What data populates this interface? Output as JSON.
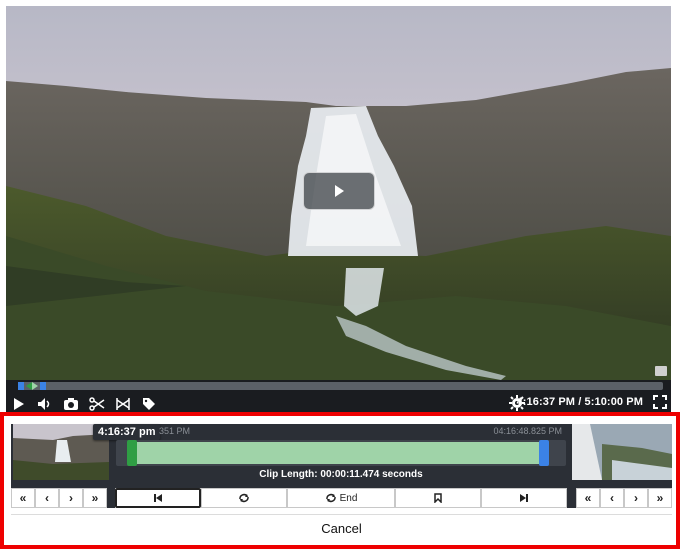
{
  "player": {
    "current_time": "4:16:37 PM",
    "separator": "/",
    "end_time": "5:10:00 PM",
    "icons": {
      "play": "play-icon",
      "volume": "volume-icon",
      "snapshot": "camera-icon",
      "clip": "scissors-icon",
      "export": "export-icon",
      "tag": "tag-icon",
      "settings": "gear-icon",
      "fullscreen": "fullscreen-icon"
    }
  },
  "clip_editor": {
    "hover_time": "4:16:37 pm",
    "range_start_label": "351 PM",
    "range_end_label": "04:16:48.825 PM",
    "clip_length": "Clip Length: 00:00:11.474 seconds",
    "nav_left": [
      "«",
      "‹",
      "›",
      "»"
    ],
    "nav_right": [
      "«",
      "‹",
      "›",
      "»"
    ],
    "end_label": "End",
    "cancel_label": "Cancel",
    "colors": {
      "selection": "#9fd3a8",
      "start_handle": "#2f9e44",
      "end_handle": "#3b82e6",
      "highlight_border": "#ee0000"
    }
  }
}
